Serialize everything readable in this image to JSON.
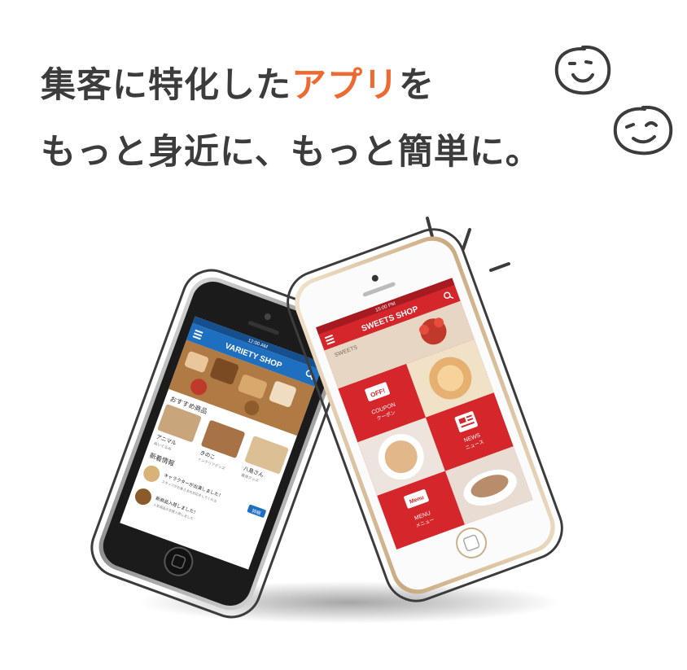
{
  "headline": {
    "line1_pre": "集客に特化した",
    "line1_accent": "アプリ",
    "line1_post": "を",
    "line2": "もっと身近に、もっと簡単に。"
  },
  "colors": {
    "text": "#3c3c3c",
    "accent": "#ee6a33",
    "variety_blue": "#1e6fc0",
    "sweets_red": "#d5262c"
  },
  "icons": [
    "smiley-face-icon",
    "winking-face-icon",
    "sparkle-lines-icon",
    "hamburger-menu-icon",
    "search-icon"
  ],
  "phone_left": {
    "status_time": "12:00 AM",
    "app_title": "VARIETY SHOP",
    "section_recommended": "おすすめ商品",
    "products": [
      {
        "name": "アニマル",
        "desc": "ぬいぐるみ"
      },
      {
        "name": "きのこ",
        "desc": "インテリアグッズ"
      },
      {
        "name": "八島さん",
        "desc": "雑貨グッズ"
      }
    ],
    "section_news": "新着情報",
    "news": [
      {
        "title": "キャラクターが出演しました！",
        "sub": "スタッフがお客さまの対応をしてくれる",
        "button": "詳細"
      },
      {
        "title": "新商品入荷しました！",
        "sub": "人気商品が多数入荷しました",
        "button": ""
      }
    ]
  },
  "phone_right": {
    "status_time": "15:00 PM",
    "app_title": "SWEETS SHOP",
    "subtitle": "SWEETS",
    "tiles": [
      {
        "label": "COUPON",
        "sub": "クーポン",
        "icon": "OFF!"
      },
      {
        "label": "NEWS",
        "sub": "ニュース",
        "icon": "news-icon"
      },
      {
        "label": "MENU",
        "sub": "メニュー",
        "icon": "Menu"
      }
    ]
  }
}
